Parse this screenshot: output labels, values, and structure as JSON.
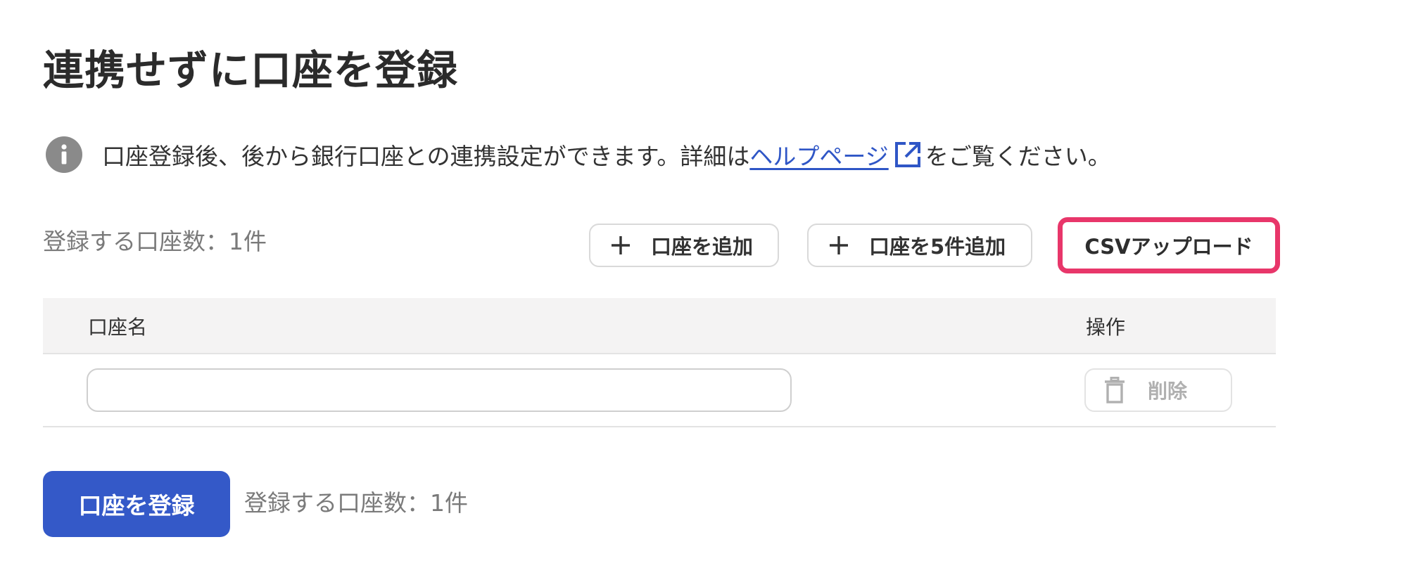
{
  "page": {
    "title": "連携せずに口座を登録"
  },
  "info": {
    "icon": "info-icon",
    "text_before": "口座登録後、後から銀行口座との連携設定ができます。詳細は",
    "link_text": "ヘルプページ",
    "link_icon": "external-link-icon",
    "text_after": "をご覧ください。"
  },
  "toolbar": {
    "count_text": "登録する口座数：1件",
    "add_one_label": "口座を追加",
    "add_five_label": "口座を5件追加",
    "csv_upload_label": "CSVアップロード",
    "add_icon": "plus-icon"
  },
  "table": {
    "columns": [
      "口座名",
      "操作"
    ],
    "rows": [
      {
        "account_name_value": "",
        "delete_label": "削除",
        "delete_icon": "trash-icon"
      }
    ]
  },
  "footer": {
    "submit_label": "口座を登録",
    "count_text": "登録する口座数：1件"
  },
  "colors": {
    "primary": "#3459c8",
    "link": "#2f56c6",
    "highlight_border": "#e8366a",
    "header_bg": "#f4f3f3",
    "muted_text": "#7a7a7a",
    "info_icon": "#8a8a8a"
  }
}
